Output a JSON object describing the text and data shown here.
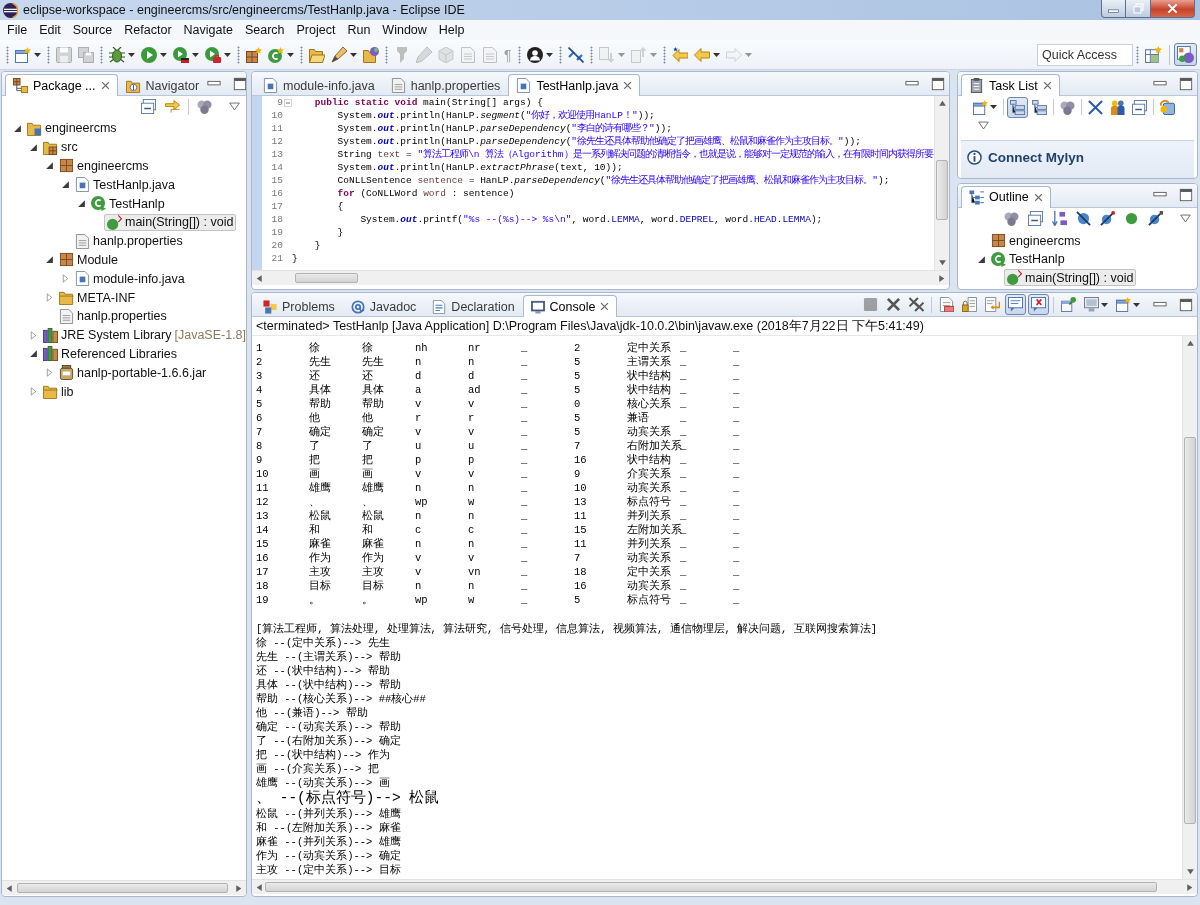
{
  "window": {
    "title": "eclipse-workspace - engineercms/src/engineercms/TestHanlp.java - Eclipse IDE"
  },
  "menu": [
    "File",
    "Edit",
    "Source",
    "Refactor",
    "Navigate",
    "Search",
    "Project",
    "Run",
    "Window",
    "Help"
  ],
  "toolbar": {
    "buttons": [
      {
        "disabled": false
      },
      {
        "disabled": true
      },
      {
        "disabled": true
      },
      {
        "disabled": false
      },
      {
        "disabled": false
      },
      {
        "disabled": false
      },
      {
        "disabled": false
      },
      {
        "disabled": false
      },
      {
        "disabled": false
      },
      {
        "disabled": false
      },
      {
        "disabled": false
      },
      {
        "disabled": false
      },
      {
        "disabled": true
      },
      {
        "disabled": true
      },
      {
        "disabled": true
      },
      {
        "disabled": true
      },
      {
        "disabled": true
      },
      {
        "disabled": true,
        "label": "¶"
      },
      {
        "disabled": false
      },
      {
        "disabled": false
      },
      {
        "disabled": true
      },
      {
        "disabled": true
      },
      {
        "disabled": false
      },
      {
        "disabled": false
      },
      {
        "disabled": true
      }
    ],
    "quick_access": {
      "placeholder": "Quick Access"
    },
    "perspectives": [
      {
        "selected": false
      },
      {
        "selected": true
      }
    ]
  },
  "package_explorer": {
    "tabs": [
      {
        "label": "Package ...",
        "selected": true
      },
      {
        "label": "Navigator",
        "selected": false
      }
    ],
    "tree": [
      {
        "label": "engineercms",
        "kind": "project",
        "expanded": true,
        "selected": false,
        "children": [
          {
            "label": "src",
            "kind": "source-folder",
            "expanded": true,
            "selected": false,
            "children": [
              {
                "label": "engineercms",
                "kind": "package",
                "expanded": true,
                "selected": false,
                "children": [
                  {
                    "label": "TestHanlp.java",
                    "kind": "java-file",
                    "expanded": true,
                    "selected": false,
                    "children": [
                      {
                        "label": "TestHanlp",
                        "kind": "class",
                        "expanded": true,
                        "selected": false,
                        "children": [
                          {
                            "label": "main(String[]) : void",
                            "kind": "method",
                            "selected": true
                          }
                        ]
                      }
                    ]
                  },
                  {
                    "label": "hanlp.properties",
                    "kind": "file",
                    "selected": false
                  }
                ]
              },
              {
                "label": "Module",
                "kind": "package",
                "expanded": true,
                "selected": false,
                "children": [
                  {
                    "label": "module-info.java",
                    "kind": "java-file",
                    "expanded": false,
                    "selected": false
                  }
                ]
              },
              {
                "label": "META-INF",
                "kind": "folder",
                "expanded": false,
                "selected": false
              },
              {
                "label": "hanlp.properties",
                "kind": "file",
                "selected": false
              }
            ]
          },
          {
            "label": "JRE System Library",
            "decoration": "[JavaSE-1.8]",
            "kind": "library",
            "expanded": false,
            "selected": false
          },
          {
            "label": "Referenced Libraries",
            "kind": "library",
            "expanded": true,
            "selected": false,
            "children": [
              {
                "label": "hanlp-portable-1.6.6.jar",
                "kind": "jar",
                "expanded": false,
                "selected": false
              }
            ]
          },
          {
            "label": "lib",
            "kind": "folder",
            "expanded": false,
            "selected": false
          }
        ]
      }
    ]
  },
  "editor": {
    "tabs": [
      {
        "label": "module-info.java",
        "kind": "java-file",
        "selected": false
      },
      {
        "label": "hanlp.properties",
        "kind": "file",
        "selected": false
      },
      {
        "label": "TestHanlp.java",
        "kind": "java-file",
        "selected": true
      }
    ],
    "lines": [
      {
        "number": "9",
        "expanded": true,
        "tokens": [
          {
            "text": "    public static void",
            "kind": "keyword"
          },
          {
            "text": " main(String[] args) {",
            "kind": "plain"
          }
        ]
      },
      {
        "number": "10",
        "tokens": [
          {
            "text": "        System.",
            "kind": "plain"
          },
          {
            "text": "out",
            "kind": "static-field"
          },
          {
            "text": ".println(HanLP.",
            "kind": "plain"
          },
          {
            "text": "segment",
            "kind": "static-method"
          },
          {
            "text": "(",
            "kind": "plain"
          },
          {
            "text": "\"你好，欢迎使用HanLP！\"",
            "kind": "string"
          },
          {
            "text": "));",
            "kind": "plain"
          }
        ]
      },
      {
        "number": "11",
        "tokens": [
          {
            "text": "        System.",
            "kind": "plain"
          },
          {
            "text": "out",
            "kind": "static-field"
          },
          {
            "text": ".println(HanLP.",
            "kind": "plain"
          },
          {
            "text": "parseDependency",
            "kind": "static-method"
          },
          {
            "text": "(",
            "kind": "plain"
          },
          {
            "text": "\"李白的诗有哪些？\"",
            "kind": "string"
          },
          {
            "text": "));",
            "kind": "plain"
          }
        ]
      },
      {
        "number": "12",
        "tokens": [
          {
            "text": "        System.",
            "kind": "plain"
          },
          {
            "text": "out",
            "kind": "static-field"
          },
          {
            "text": ".println(HanLP.",
            "kind": "plain"
          },
          {
            "text": "parseDependency",
            "kind": "static-method"
          },
          {
            "text": "(",
            "kind": "plain"
          },
          {
            "text": "\"徐先生还具体帮助他确定了把画雄鹰、松鼠和麻雀作为主攻目标。\"",
            "kind": "string"
          },
          {
            "text": "));",
            "kind": "plain"
          }
        ]
      },
      {
        "number": "13",
        "tokens": [
          {
            "text": "        String ",
            "kind": "plain"
          },
          {
            "text": "text",
            "kind": "variable"
          },
          {
            "text": " = ",
            "kind": "plain"
          },
          {
            "text": "\"算法工程师\\n 算法（Algorithm）是一系列解决问题的清晰指令，也就是说，能够对一定规范的输入，在有限时间内获得所要",
            "kind": "string"
          }
        ]
      },
      {
        "number": "14",
        "tokens": [
          {
            "text": "        System.",
            "kind": "plain"
          },
          {
            "text": "out",
            "kind": "static-field"
          },
          {
            "text": ".println(HanLP.",
            "kind": "plain"
          },
          {
            "text": "extractPhrase",
            "kind": "static-method"
          },
          {
            "text": "(text, 10));",
            "kind": "plain"
          }
        ]
      },
      {
        "number": "15",
        "tokens": [
          {
            "text": "        CoNLLSentence ",
            "kind": "plain"
          },
          {
            "text": "sentence",
            "kind": "variable"
          },
          {
            "text": " = HanLP.",
            "kind": "plain"
          },
          {
            "text": "parseDependency",
            "kind": "static-method"
          },
          {
            "text": "(",
            "kind": "plain"
          },
          {
            "text": "\"徐先生还具体帮助他确定了把画雄鹰、松鼠和麻雀作为主攻目标。\"",
            "kind": "string"
          },
          {
            "text": ");",
            "kind": "plain"
          }
        ]
      },
      {
        "number": "16",
        "tokens": [
          {
            "text": "        for",
            "kind": "keyword"
          },
          {
            "text": " (CoNLLWord ",
            "kind": "plain"
          },
          {
            "text": "word",
            "kind": "variable"
          },
          {
            "text": " : sentence)",
            "kind": "plain"
          }
        ]
      },
      {
        "number": "17",
        "tokens": [
          {
            "text": "        {",
            "kind": "plain"
          }
        ]
      },
      {
        "number": "18",
        "tokens": [
          {
            "text": "            System.",
            "kind": "plain"
          },
          {
            "text": "out",
            "kind": "static-field"
          },
          {
            "text": ".printf(",
            "kind": "plain"
          },
          {
            "text": "\"%s --(%s)--> %s\\n\"",
            "kind": "string"
          },
          {
            "text": ", word.",
            "kind": "plain"
          },
          {
            "text": "LEMMA",
            "kind": "field"
          },
          {
            "text": ", word.",
            "kind": "plain"
          },
          {
            "text": "DEPREL",
            "kind": "field"
          },
          {
            "text": ", word.",
            "kind": "plain"
          },
          {
            "text": "HEAD",
            "kind": "field"
          },
          {
            "text": ".",
            "kind": "plain"
          },
          {
            "text": "LEMMA",
            "kind": "field"
          },
          {
            "text": ");",
            "kind": "plain"
          }
        ]
      },
      {
        "number": "19",
        "tokens": [
          {
            "text": "        }",
            "kind": "plain"
          }
        ]
      },
      {
        "number": "20",
        "tokens": [
          {
            "text": "    }",
            "kind": "plain"
          }
        ]
      },
      {
        "number": "21",
        "tokens": [
          {
            "text": "}",
            "kind": "plain"
          }
        ]
      }
    ]
  },
  "task_list": {
    "title": "Task List",
    "toolbar": [
      {
        "on": false
      },
      {
        "on": true
      },
      {
        "on": false
      },
      {
        "on": false
      },
      {
        "on": false
      },
      {
        "on": false
      },
      {
        "on": false
      },
      {
        "on": false
      }
    ],
    "connect_link": "Connect Mylyn"
  },
  "outline": {
    "title": "Outline",
    "tree": [
      {
        "label": "engineercms",
        "kind": "package",
        "selected": false
      },
      {
        "label": "TestHanlp",
        "kind": "class",
        "expanded": true,
        "selected": false,
        "children": [
          {
            "label": "main(String[]) : void",
            "kind": "method",
            "selected": true
          }
        ]
      }
    ]
  },
  "console_view": {
    "tabs": [
      {
        "label": "Problems",
        "selected": false
      },
      {
        "label": "Javadoc",
        "selected": false
      },
      {
        "label": "Declaration",
        "selected": false
      },
      {
        "label": "Console",
        "selected": true
      }
    ],
    "toolbar": [
      {
        "disabled": true,
        "on": false
      },
      {
        "disabled": false,
        "on": false
      },
      {
        "disabled": false,
        "on": false
      },
      {
        "disabled": false,
        "on": false
      },
      {
        "disabled": false,
        "on": false
      },
      {
        "disabled": false,
        "on": false
      },
      {
        "disabled": false,
        "on": true
      },
      {
        "disabled": false,
        "on": true
      },
      {
        "disabled": false,
        "on": false
      },
      {
        "disabled": false,
        "on": false
      },
      {
        "disabled": false,
        "on": false
      }
    ],
    "status": "<terminated> TestHanlp [Java Application] D:\\Program Files\\Java\\jdk-10.0.2\\bin\\javaw.exe (2018年7月22日 下午5:41:49)",
    "rows": [
      [
        "1",
        "徐",
        "徐",
        "nh",
        "nr",
        "_",
        "2",
        "定中关系",
        "_",
        "_"
      ],
      [
        "2",
        "先生",
        "先生",
        "n",
        "n",
        "_",
        "5",
        "主谓关系",
        "_",
        "_"
      ],
      [
        "3",
        "还",
        "还",
        "d",
        "d",
        "_",
        "5",
        "状中结构",
        "_",
        "_"
      ],
      [
        "4",
        "具体",
        "具体",
        "a",
        "ad",
        "_",
        "5",
        "状中结构",
        "_",
        "_"
      ],
      [
        "5",
        "帮助",
        "帮助",
        "v",
        "v",
        "_",
        "0",
        "核心关系",
        "_",
        "_"
      ],
      [
        "6",
        "他",
        "他",
        "r",
        "r",
        "_",
        "5",
        "兼语",
        "_",
        "_"
      ],
      [
        "7",
        "确定",
        "确定",
        "v",
        "v",
        "_",
        "5",
        "动宾关系",
        "_",
        "_"
      ],
      [
        "8",
        "了",
        "了",
        "u",
        "u",
        "_",
        "7",
        "右附加关系",
        "_",
        "_"
      ],
      [
        "9",
        "把",
        "把",
        "p",
        "p",
        "_",
        "16",
        "状中结构",
        "_",
        "_"
      ],
      [
        "10",
        "画",
        "画",
        "v",
        "v",
        "_",
        "9",
        "介宾关系",
        "_",
        "_"
      ],
      [
        "11",
        "雄鹰",
        "雄鹰",
        "n",
        "n",
        "_",
        "10",
        "动宾关系",
        "_",
        "_"
      ],
      [
        "12",
        "、",
        "、",
        "wp",
        "w",
        "_",
        "13",
        "标点符号",
        "_",
        "_"
      ],
      [
        "13",
        "松鼠",
        "松鼠",
        "n",
        "n",
        "_",
        "11",
        "并列关系",
        "_",
        "_"
      ],
      [
        "14",
        "和",
        "和",
        "c",
        "c",
        "_",
        "15",
        "左附加关系",
        "_",
        "_"
      ],
      [
        "15",
        "麻雀",
        "麻雀",
        "n",
        "n",
        "_",
        "11",
        "并列关系",
        "_",
        "_"
      ],
      [
        "16",
        "作为",
        "作为",
        "v",
        "v",
        "_",
        "7",
        "动宾关系",
        "_",
        "_"
      ],
      [
        "17",
        "主攻",
        "主攻",
        "v",
        "vn",
        "_",
        "18",
        "定中关系",
        "_",
        "_"
      ],
      [
        "18",
        "目标",
        "目标",
        "n",
        "n",
        "_",
        "16",
        "动宾关系",
        "_",
        "_"
      ],
      [
        "19",
        "。",
        "。",
        "wp",
        "w",
        "_",
        "5",
        "标点符号",
        "_",
        "_"
      ]
    ],
    "lines": [
      {
        "text": "[算法工程师, 算法处理, 处理算法, 算法研究, 信号处理, 信息算法, 视频算法, 通信物理层, 解决问题, 互联网搜索算法]",
        "kind": "normal"
      },
      {
        "text": "徐 --(定中关系)--> 先生",
        "kind": "normal"
      },
      {
        "text": "先生 --(主谓关系)--> 帮助",
        "kind": "normal"
      },
      {
        "text": "还 --(状中结构)--> 帮助",
        "kind": "normal"
      },
      {
        "text": "具体 --(状中结构)--> 帮助",
        "kind": "normal"
      },
      {
        "text": "帮助 --(核心关系)--> ##核心##",
        "kind": "normal"
      },
      {
        "text": "他 --(兼语)--> 帮助",
        "kind": "normal"
      },
      {
        "text": "确定 --(动宾关系)--> 帮助",
        "kind": "normal"
      },
      {
        "text": "了 --(右附加关系)--> 确定",
        "kind": "normal"
      },
      {
        "text": "把 --(状中结构)--> 作为",
        "kind": "normal"
      },
      {
        "text": "画 --(介宾关系)--> 把",
        "kind": "normal"
      },
      {
        "text": "雄鹰 --(动宾关系)--> 画",
        "kind": "normal"
      },
      {
        "text": "、 --(标点符号)--> 松鼠",
        "kind": "large"
      },
      {
        "text": "松鼠 --(并列关系)--> 雄鹰",
        "kind": "normal"
      },
      {
        "text": "和 --(左附加关系)--> 麻雀",
        "kind": "normal"
      },
      {
        "text": "麻雀 --(并列关系)--> 雄鹰",
        "kind": "normal"
      },
      {
        "text": "作为 --(动宾关系)--> 确定",
        "kind": "normal"
      },
      {
        "text": "主攻 --(定中关系)--> 目标",
        "kind": "normal"
      }
    ]
  }
}
